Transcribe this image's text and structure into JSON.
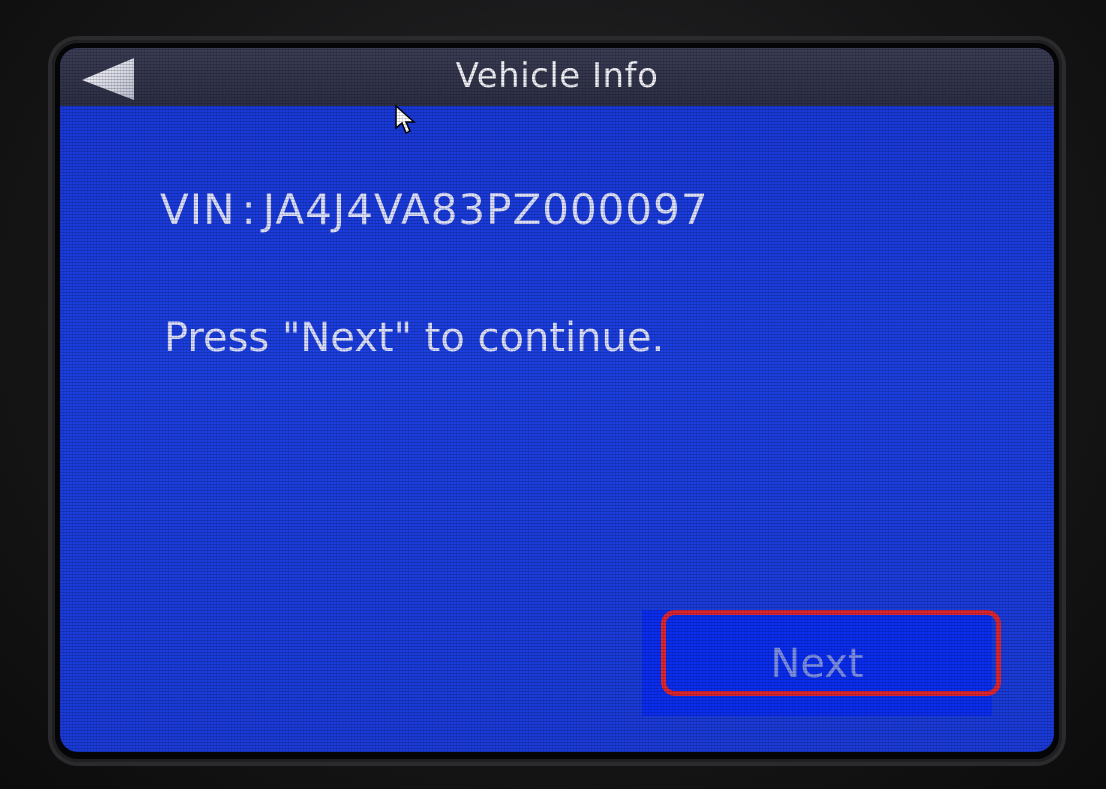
{
  "window": {
    "title": "Vehicle Info"
  },
  "nav": {
    "back_icon": "back-arrow-icon"
  },
  "content": {
    "vin_label": "VIN",
    "vin_separator": ":",
    "vin_value": "JA4J4VA83PZ000097",
    "instruction": "Press \"Next\" to continue."
  },
  "actions": {
    "next_label": "Next"
  },
  "colors": {
    "screen_background": "#1c3fe0",
    "titlebar_background": "#2c2e42",
    "button_background": "#0a2ef0",
    "highlight": "#e0262f"
  }
}
